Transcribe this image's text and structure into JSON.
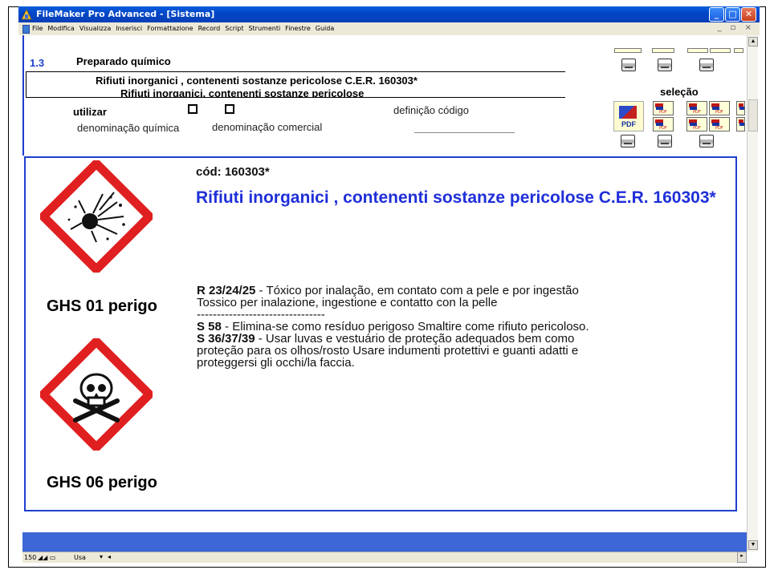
{
  "window": {
    "title": "FileMaker Pro Advanced - [Sistema]",
    "buttons": {
      "minimize": "_",
      "maximize": "□",
      "close": "✕"
    }
  },
  "menu": {
    "items": [
      "File",
      "Modifica",
      "Visualizza",
      "Inserisci",
      "Formattazione",
      "Record",
      "Script",
      "Strumenti",
      "Finestre",
      "Guida"
    ],
    "mdi_controls": "_ ▫ ×"
  },
  "header": {
    "section_number": "1.3",
    "section_title": "Preparado químico",
    "name_line1": "Rifiuti inorganici , contenenti sostanze pericolose C.E.R. 160303*",
    "name_line2": "Rifiuti inorganici, contenenti sostanze pericolose",
    "use_label": "utilizar",
    "definition_code_label": "definição código",
    "chemical_name_label": "denominação química",
    "commercial_name_label": "denominação comercial",
    "selection_label": "seleção",
    "pdf_label": "PDF",
    "pdf_small_label": "PDF"
  },
  "main": {
    "code": "cód: 160303*",
    "product_name": "Rifiuti inorganici , contenenti sostanze pericolose C.E.R. 160303*",
    "pictogram1_label": "GHS 01 perigo",
    "pictogram2_label": "GHS 06 perigo",
    "phrases": {
      "r_code": "R 23/24/25",
      "r_text_pt": " - Tóxico por inalação, em contato com a pele e por ingestão",
      "r_text_it": "Tossico per inalazione, ingestione e contatto con la pelle",
      "separator": "--------------------------------",
      "s1_code": "S 58",
      "s1_text": " - Elimina-se como resíduo perigoso  Smaltire come rifiuto pericoloso.",
      "s2_code": "S 36/37/39",
      "s2_text_a": " - Usar luvas e vestuário de proteção adequados bem como",
      "s2_text_b": "proteção para os olhos/rosto  Usare indumenti protettivi e guanti adatti e",
      "s2_text_c": "proteggersi gli occhi/la faccia."
    }
  },
  "status": {
    "zoom": "150",
    "mode": "Usa"
  },
  "colors": {
    "accent_blue": "#1f3fcf",
    "product_name_blue": "#1f2fd8",
    "pictogram_red": "#e02020",
    "bottom_band": "#3d67d6"
  },
  "icons": [
    "filemaker-icon",
    "explosive-pictogram-icon",
    "skull-crossbones-pictogram-icon",
    "printer-icon",
    "pdf-icon"
  ]
}
